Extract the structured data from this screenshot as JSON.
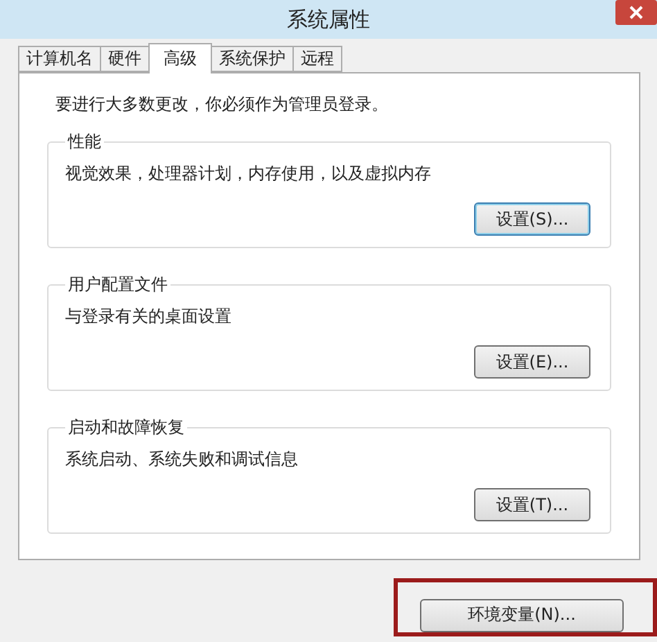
{
  "window": {
    "title": "系统属性"
  },
  "tabs": [
    {
      "label": "计算机名",
      "selected": false
    },
    {
      "label": "硬件",
      "selected": false
    },
    {
      "label": "高级",
      "selected": true
    },
    {
      "label": "系统保护",
      "selected": false
    },
    {
      "label": "远程",
      "selected": false
    }
  ],
  "notice": "要进行大多数更改，你必须作为管理员登录。",
  "groups": [
    {
      "title": "性能",
      "description": "视觉效果，处理器计划，内存使用，以及虚拟内存",
      "button": {
        "label": "设置(S)...",
        "focused": true
      }
    },
    {
      "title": "用户配置文件",
      "description": "与登录有关的桌面设置",
      "button": {
        "label": "设置(E)...",
        "focused": false
      }
    },
    {
      "title": "启动和故障恢复",
      "description": "系统启动、系统失败和调试信息",
      "button": {
        "label": "设置(T)...",
        "focused": false
      }
    }
  ],
  "env_button": {
    "label": "环境变量(N)...",
    "highlighted": true
  }
}
